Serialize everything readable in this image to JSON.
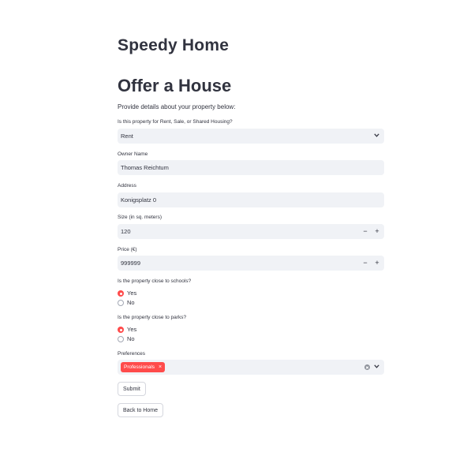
{
  "app_title": "Speedy Home",
  "page_title": "Offer a House",
  "intro": "Provide details about your property below:",
  "listing_type": {
    "label": "Is this property for Rent, Sale, or Shared Housing?",
    "value": "Rent"
  },
  "owner_name": {
    "label": "Owner Name",
    "value": "Thomas Reichtum"
  },
  "address": {
    "label": "Address",
    "value": "Konigsplatz 0"
  },
  "size": {
    "label": "Size (in sq. meters)",
    "value": "120",
    "minus": "−",
    "plus": "+"
  },
  "price": {
    "label": "Price (€)",
    "value": "999999",
    "minus": "−",
    "plus": "+"
  },
  "schools": {
    "label": "Is the property close to schools?",
    "options": [
      "Yes",
      "No"
    ],
    "selected": "Yes"
  },
  "parks": {
    "label": "Is the property close to parks?",
    "options": [
      "Yes",
      "No"
    ],
    "selected": "Yes"
  },
  "preferences": {
    "label": "Preferences",
    "tags": [
      "Professionals"
    ],
    "tag_remove": "×"
  },
  "buttons": {
    "submit": "Submit",
    "back": "Back to Home"
  },
  "colors": {
    "accent": "#ff4b4b",
    "field_bg": "#f0f2f6",
    "text": "#31333f"
  },
  "icons": {
    "select_chevron": "chevron-down-icon",
    "clear": "clear-icon"
  }
}
